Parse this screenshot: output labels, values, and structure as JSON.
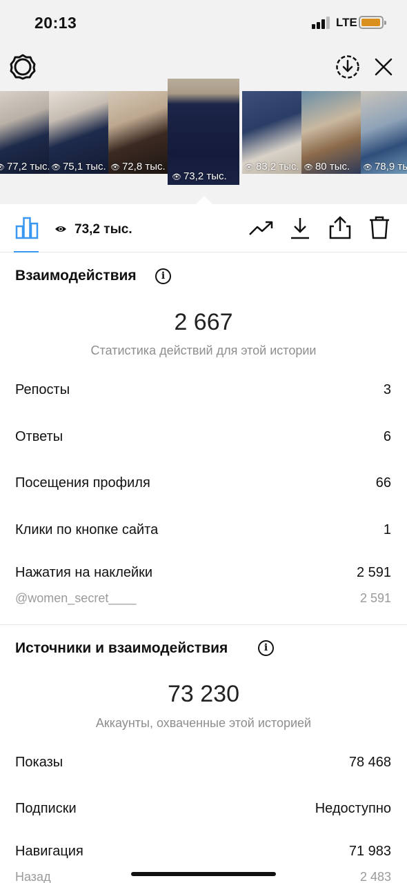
{
  "status_bar": {
    "time": "20:13",
    "network": "LTE"
  },
  "top_bar": {
    "settings_icon": "gear-icon",
    "download_icon": "circle-download-icon",
    "close_icon": "close-icon"
  },
  "thumbnails": [
    {
      "views": "77,2 тыс."
    },
    {
      "views": "75,1 тыс."
    },
    {
      "views": "72,8 тыс."
    },
    {
      "views": "73,2 тыс.",
      "active": true
    },
    {
      "views": "83,2 тыс."
    },
    {
      "views": "80 тыс."
    },
    {
      "views": "78,9 тыс."
    }
  ],
  "toolbar": {
    "reach": "73,2 тыс."
  },
  "interactions": {
    "title": "Взаимодействия",
    "total": "2 667",
    "caption": "Статистика действий для этой истории",
    "rows": [
      {
        "label": "Репосты",
        "value": "3"
      },
      {
        "label": "Ответы",
        "value": "6"
      },
      {
        "label": "Посещения профиля",
        "value": "66"
      },
      {
        "label": "Клики по кнопке сайта",
        "value": "1"
      },
      {
        "label": "Нажатия на наклейки",
        "value": "2 591"
      }
    ],
    "sticker": {
      "label": "@women_secret____",
      "value": "2 591"
    }
  },
  "discovery": {
    "title": "Источники и взаимодействия",
    "total": "73 230",
    "caption": "Аккаунты, охваченные этой историей",
    "rows": [
      {
        "label": "Показы",
        "value": "78 468"
      },
      {
        "label": "Подписки",
        "value": "Недоступно"
      },
      {
        "label": "Навигация",
        "value": "71 983"
      }
    ],
    "sub_row": {
      "label": "Назад",
      "value": "2 483"
    }
  }
}
